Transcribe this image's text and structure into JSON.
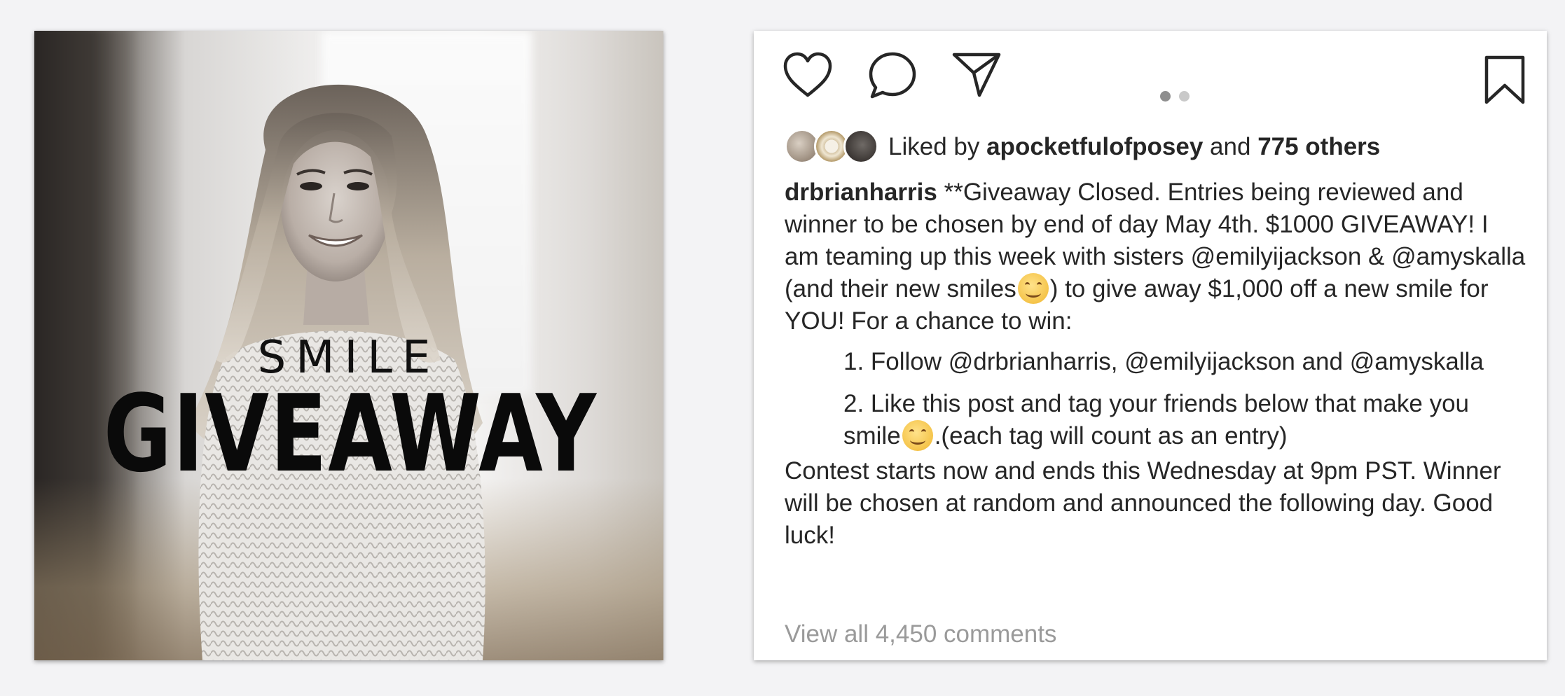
{
  "post_image": {
    "word_small": "SMILE",
    "word_large": "GIVEAWAY"
  },
  "actions": {
    "like_icon": "heart-icon",
    "comment_icon": "speech-bubble-icon",
    "share_icon": "paper-plane-icon",
    "save_icon": "bookmark-icon",
    "carousel_pages": 2,
    "carousel_active": 1
  },
  "likes": {
    "prefix": "Liked by ",
    "user": "apocketfulofposey",
    "middle": " and ",
    "others": "775 others"
  },
  "caption": {
    "username": "drbrianharris",
    "intro_text": " **Giveaway Closed. Entries being reviewed and winner to be chosen by end of day May 4th. $1000 GIVEAWAY!  I am teaming up this week with sisters @emilyijackson & @amyskalla (and their new smiles",
    "intro_tail": ") to give away $1,000 off a new smile for YOU! For a chance to win:",
    "step1": "1. Follow @drbrianharris, @emilyijackson and @amyskalla",
    "step2_text": "2. Like this post and tag your friends below that make you smile",
    "step2_tail": ".(each tag will count as an entry)",
    "outro": "Contest starts now and ends this Wednesday at 9pm PST. Winner will be chosen at random and announced the following day. Good luck!",
    "emoji": "smiling-face-emoji"
  },
  "comments": {
    "link_text": "View all 4,450 comments"
  }
}
